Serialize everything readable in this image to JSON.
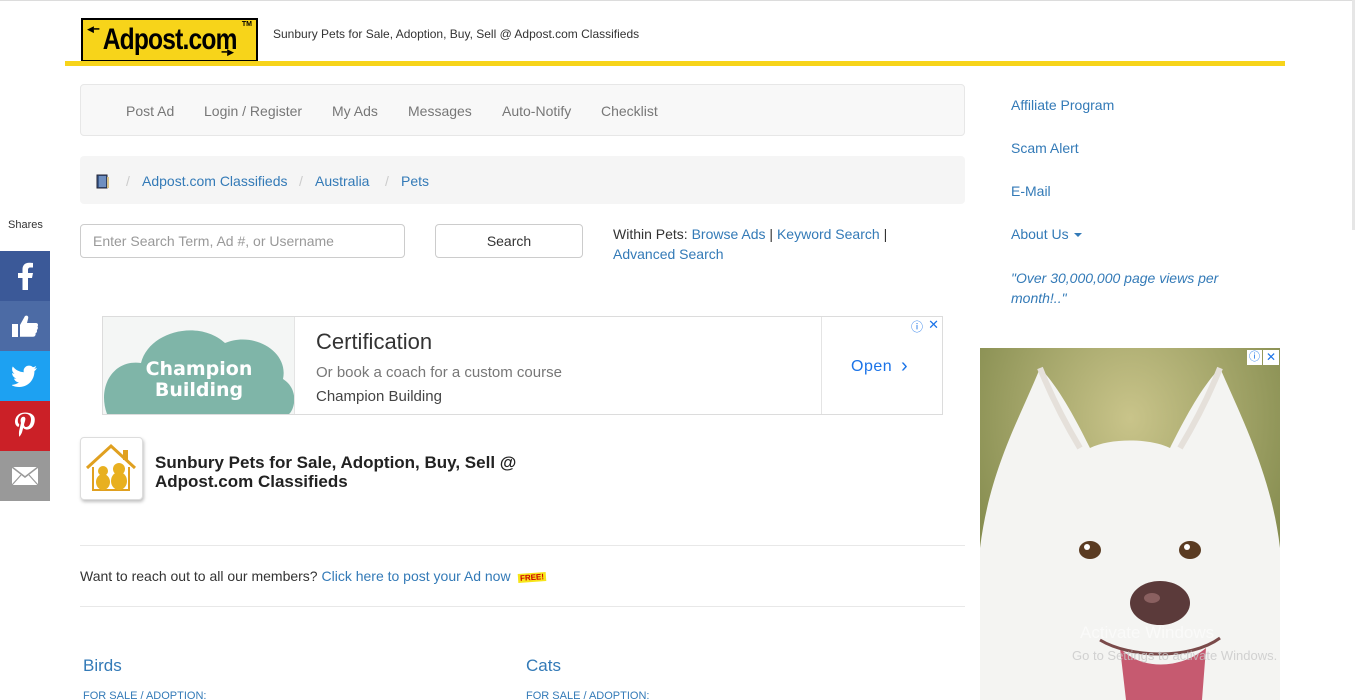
{
  "header": {
    "logo_text": "Adpost.com",
    "logo_tm": "TM",
    "tagline": "Sunbury Pets for Sale, Adoption, Buy, Sell @ Adpost.com Classifieds",
    "accent_color": "#f7d41a"
  },
  "nav": {
    "items": [
      "Post Ad",
      "Login / Register",
      "My Ads",
      "Messages",
      "Auto-Notify",
      "Checklist"
    ]
  },
  "breadcrumb": {
    "icon": "book-icon",
    "items": [
      "Adpost.com Classifieds",
      "Australia",
      "Pets"
    ],
    "separator": "/"
  },
  "search": {
    "placeholder": "Enter Search Term, Ad #, or Username",
    "button_label": "Search",
    "within_label": "Within Pets:",
    "links": [
      "Browse Ads",
      "Keyword Search",
      "Advanced Search"
    ],
    "link_separator": "|"
  },
  "ad_banner": {
    "image_text_line1": "Champion",
    "image_text_line2": "Building",
    "title": "Certification",
    "subtitle": "Or book a coach for a custom course",
    "brand": "Champion Building",
    "cta": "Open",
    "cta_icon": "chevron-right-icon",
    "info_icon": "ⓘ",
    "close_icon": "✕"
  },
  "page": {
    "title": "Sunbury Pets for Sale, Adoption, Buy, Sell @ Adpost.com Classifieds",
    "reach_text": "Want to reach out to all our members?",
    "reach_link": "Click here to post your Ad now",
    "free_badge": "FREE!"
  },
  "categories": [
    {
      "name": "Birds",
      "sub": "FOR SALE / ADOPTION:"
    },
    {
      "name": "Cats",
      "sub": "FOR SALE / ADOPTION:"
    }
  ],
  "sidebar": {
    "links": [
      "Affiliate Program",
      "Scam Alert",
      "E-Mail",
      "About Us"
    ],
    "quote": "\"Over 30,000,000 page views per month!..\""
  },
  "dog_ad": {
    "info_icon": "ⓘ",
    "close_icon": "✕"
  },
  "watermark": {
    "line1": "Activate Windows",
    "line2": "Go to Settings to activate Windows."
  },
  "share": {
    "label": "Shares",
    "buttons": [
      {
        "name": "facebook",
        "color": "#3b5998"
      },
      {
        "name": "like",
        "color": "#4c6ba5"
      },
      {
        "name": "twitter",
        "color": "#1da1f2"
      },
      {
        "name": "pinterest",
        "color": "#cb2027"
      },
      {
        "name": "email",
        "color": "#999999"
      }
    ]
  }
}
